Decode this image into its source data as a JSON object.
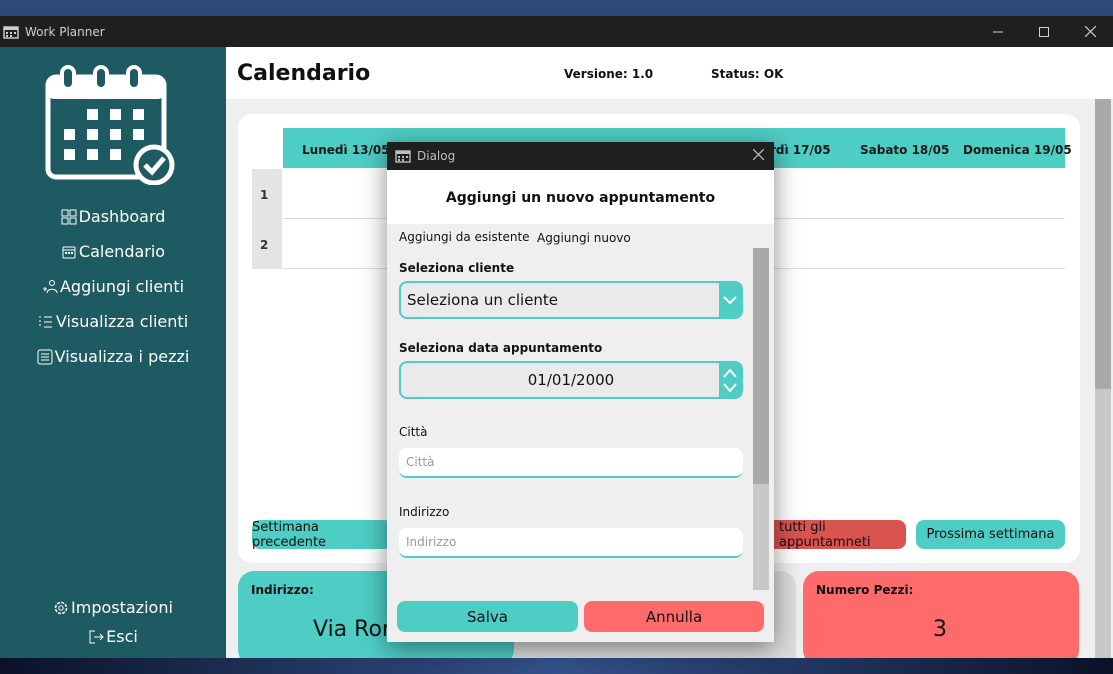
{
  "window": {
    "title": "Work Planner"
  },
  "sidebar": {
    "items": [
      {
        "label": "Dashboard",
        "icon": "dashboard-icon"
      },
      {
        "label": "Calendario",
        "icon": "calendar-icon"
      },
      {
        "label": "Aggiungi clienti",
        "icon": "add-users-icon"
      },
      {
        "label": "Visualizza clienti",
        "icon": "list-icon"
      },
      {
        "label": "Visualizza i pezzi",
        "icon": "list-box-icon"
      }
    ],
    "bottom": [
      {
        "label": "Impostazioni",
        "icon": "gear-icon"
      },
      {
        "label": "Esci",
        "icon": "logout-icon"
      }
    ]
  },
  "header": {
    "title": "Calendario",
    "version": "Versione: 1.0",
    "status": "Status: OK"
  },
  "calendar": {
    "days": [
      "Lunedì 13/05",
      "rdì 17/05",
      "Sabato 18/05",
      "Domenica 19/05"
    ],
    "rows": [
      "1",
      "2"
    ],
    "buttons": {
      "prev": "Settimana precedente",
      "all": "tutti gli appuntamneti",
      "next": "Prossima settimana"
    }
  },
  "info": {
    "address_label": "Indirizzo:",
    "address_value": "Via Ror",
    "pieces_label": "Numero Pezzi:",
    "pieces_value": "3"
  },
  "dialog": {
    "title": "Dialog",
    "heading": "Aggiungi un nuovo appuntamento",
    "tabs": [
      "Aggiungi da esistente",
      "Aggiungi nuovo"
    ],
    "client_label": "Seleziona cliente",
    "client_value": "Seleziona un cliente",
    "date_label": "Seleziona data appuntamento",
    "date_value": "01/01/2000",
    "city_label": "Città",
    "city_placeholder": "Città",
    "address_label": "Indirizzo",
    "address_placeholder": "Indirizzo",
    "save": "Salva",
    "cancel": "Annulla"
  },
  "colors": {
    "accent": "#4ecdc4",
    "danger": "#ff6b6b",
    "sidebar": "#1e5a61"
  }
}
